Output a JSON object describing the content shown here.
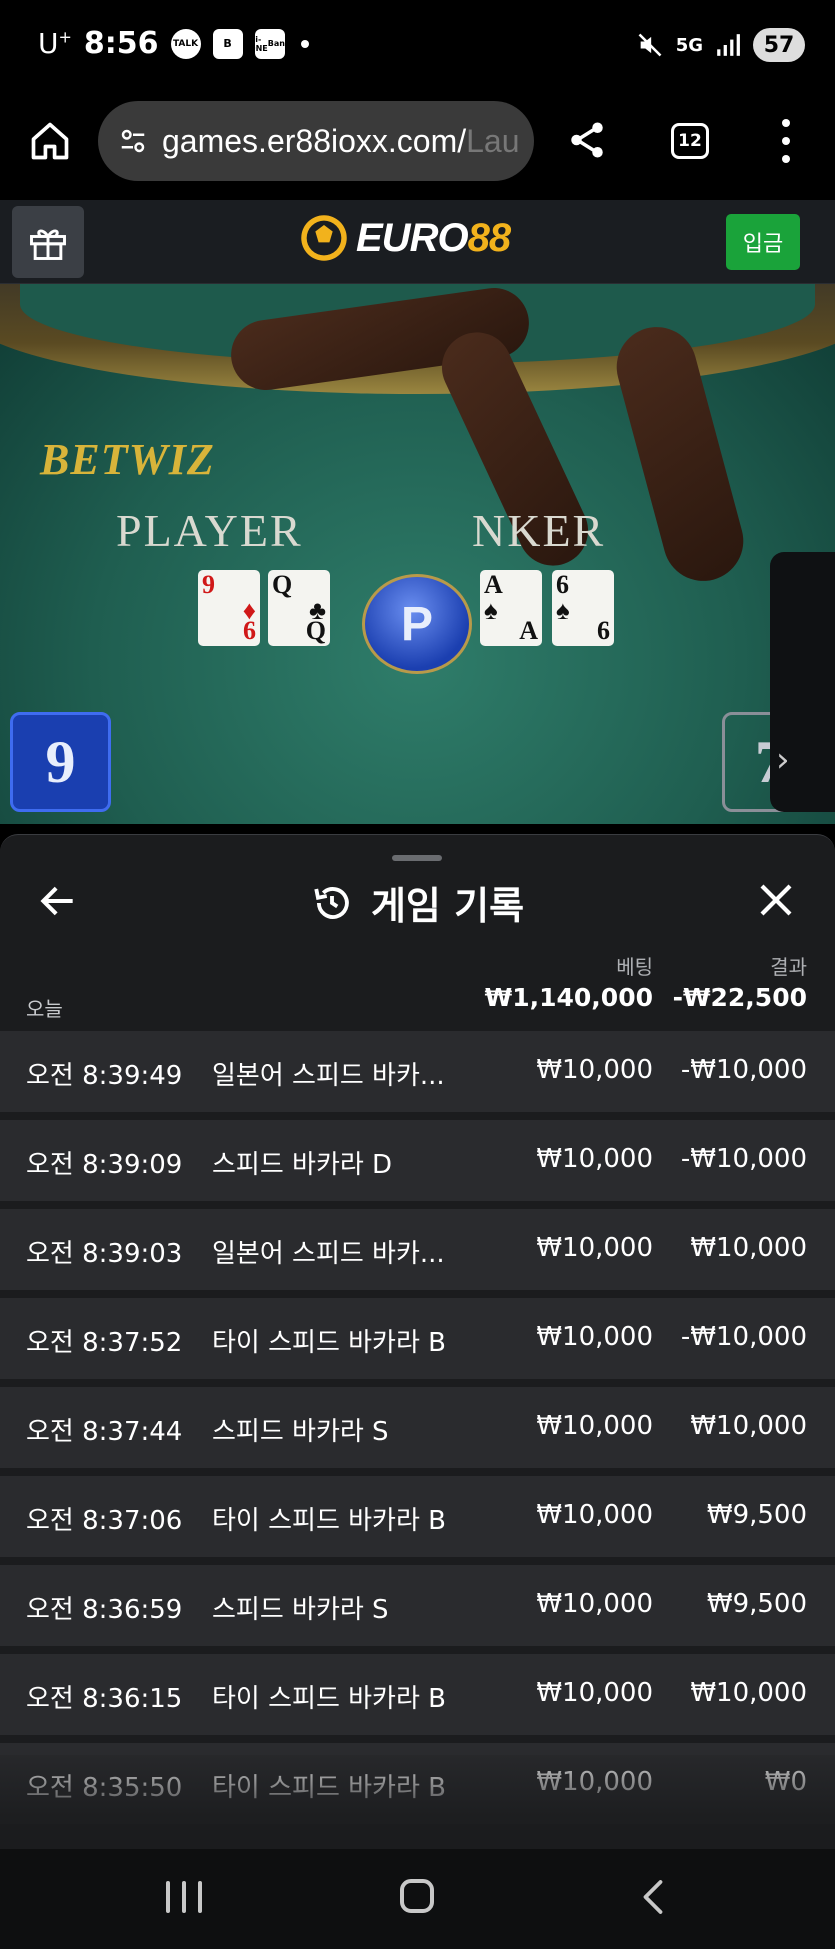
{
  "status_bar": {
    "carrier": "U",
    "carrier_sup": "+",
    "time": "8:56",
    "icons": [
      "talk-icon",
      "b-app-icon",
      "bank-icon",
      "dot"
    ],
    "talk_label": "TALK",
    "bank_label_1": "i-ONE",
    "bank_label_2": "Bank",
    "network": "5G",
    "battery": "57"
  },
  "browser": {
    "url_main": "games.er88ioxx.com/",
    "url_faded": "Lau",
    "tab_count": "12"
  },
  "site_header": {
    "logo_white": "EURO",
    "logo_yellow": "88",
    "deposit_label": "입금"
  },
  "video": {
    "table_brand": "BETWIZ",
    "player_label": "PLAYER",
    "banker_label": "NKER",
    "player_cards": [
      {
        "top": "9",
        "bottom": "6",
        "color": "red"
      },
      {
        "top": "Q",
        "bottom": "Q",
        "color": "black"
      }
    ],
    "banker_cards": [
      {
        "top": "A",
        "bottom": "A",
        "color": "black"
      },
      {
        "top": "6",
        "bottom": "6",
        "color": "black"
      }
    ],
    "winner_chip": "P",
    "player_score": "9",
    "banker_score": "7"
  },
  "sheet": {
    "title": "게임 기록",
    "col_bet": "베팅",
    "col_result": "결과",
    "today_label": "오늘",
    "total_bet": "₩1,140,000",
    "total_result": "-₩22,500",
    "rows": [
      {
        "time": "오전 8:39:49",
        "game": "일본어 스피드 바카...",
        "bet": "₩10,000",
        "result": "-₩10,000"
      },
      {
        "time": "오전 8:39:09",
        "game": "스피드 바카라 D",
        "bet": "₩10,000",
        "result": "-₩10,000"
      },
      {
        "time": "오전 8:39:03",
        "game": "일본어 스피드 바카...",
        "bet": "₩10,000",
        "result": "₩10,000"
      },
      {
        "time": "오전 8:37:52",
        "game": "타이 스피드 바카라 B",
        "bet": "₩10,000",
        "result": "-₩10,000"
      },
      {
        "time": "오전 8:37:44",
        "game": "스피드 바카라 S",
        "bet": "₩10,000",
        "result": "₩10,000"
      },
      {
        "time": "오전 8:37:06",
        "game": "타이 스피드 바카라 B",
        "bet": "₩10,000",
        "result": "₩9,500"
      },
      {
        "time": "오전 8:36:59",
        "game": "스피드 바카라 S",
        "bet": "₩10,000",
        "result": "₩9,500"
      },
      {
        "time": "오전 8:36:15",
        "game": "타이 스피드 바카라 B",
        "bet": "₩10,000",
        "result": "₩10,000"
      },
      {
        "time": "오전 8:35:50",
        "game": "타이 스피드 바카라 B",
        "bet": "₩10,000",
        "result": "₩0"
      }
    ]
  },
  "colors": {
    "deposit_green": "#1aa33a",
    "logo_yellow": "#f2b21c",
    "sheet_bg": "#1b1c1e",
    "row_bg": "#2a2b2e"
  }
}
